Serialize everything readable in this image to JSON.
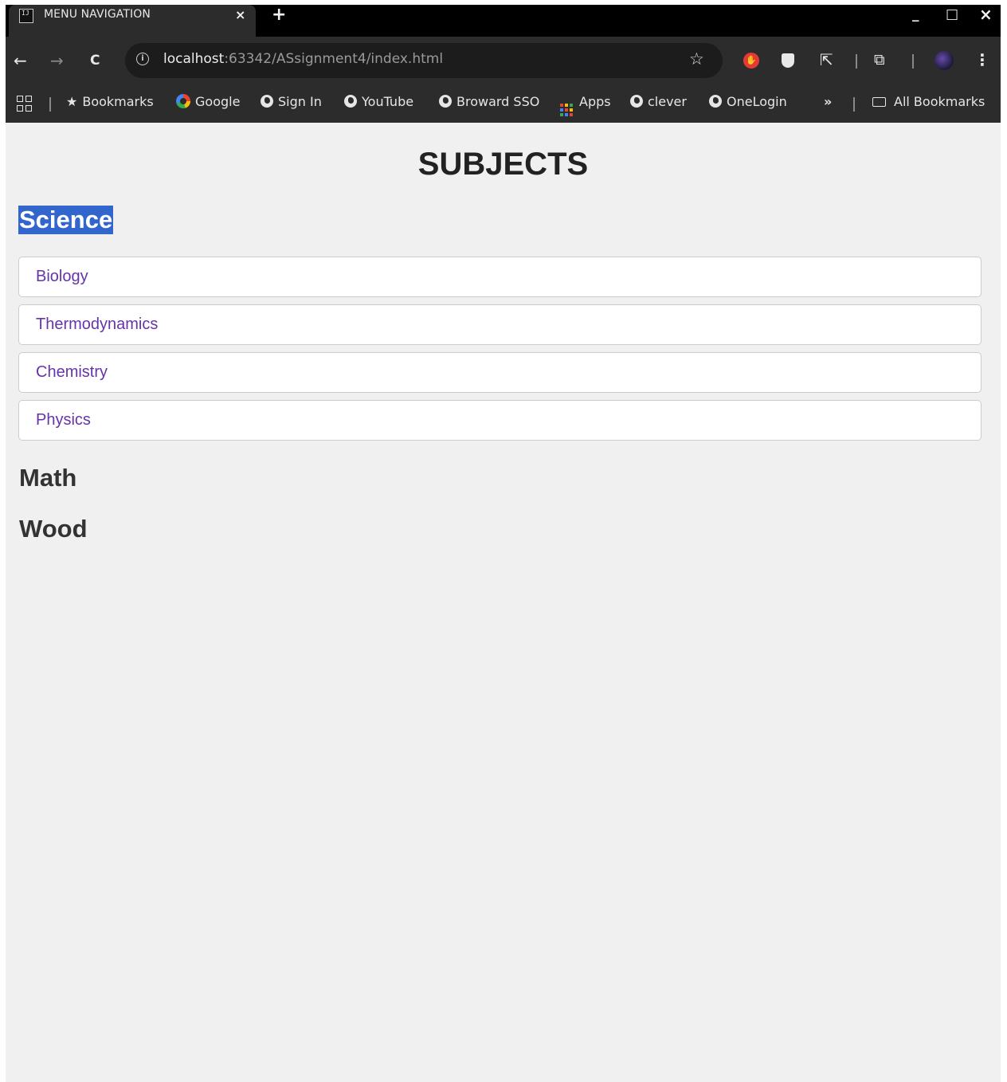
{
  "browser": {
    "tab": {
      "title": "MENU NAVIGATION",
      "close_glyph": "×",
      "favicon_text": "IJ"
    },
    "new_tab_glyph": "+",
    "window_controls": {
      "minimize": "_",
      "maximize": "□",
      "close": "×"
    },
    "toolbar": {
      "back_icon": "←",
      "forward_icon": "→",
      "reload_icon": "C",
      "url_host": "localhost",
      "url_rest": ":63342/ASsignment4/index.html",
      "star_icon": "☆",
      "menu_icon": "⋮",
      "ext_icon": "⇱",
      "reading_icon": "⧉"
    },
    "bookmarks": {
      "items": [
        {
          "label": "Bookmarks",
          "icon": "star-icon"
        },
        {
          "label": "Google",
          "icon": "google-icon"
        },
        {
          "label": "Sign In",
          "icon": "globe-icon"
        },
        {
          "label": "YouTube",
          "icon": "globe-icon"
        },
        {
          "label": "Broward SSO",
          "icon": "globe-icon"
        },
        {
          "label": "Apps",
          "icon": "apps-grid-icon"
        },
        {
          "label": "clever",
          "icon": "globe-icon"
        },
        {
          "label": "OneLogin",
          "icon": "globe-icon"
        }
      ],
      "overflow": "»",
      "all_bookmarks": "All Bookmarks"
    }
  },
  "page": {
    "title": "SUBJECTS",
    "sections": [
      {
        "heading": "Science",
        "selected": true,
        "items": [
          "Biology",
          "Thermodynamics",
          "Chemistry",
          "Physics"
        ]
      },
      {
        "heading": "Math"
      },
      {
        "heading": "Wood"
      }
    ]
  },
  "colors": {
    "selection": "#3366cc",
    "link": "#6633aa",
    "page_bg": "#f0f0f0",
    "chrome_bg": "#2c2c2c"
  }
}
